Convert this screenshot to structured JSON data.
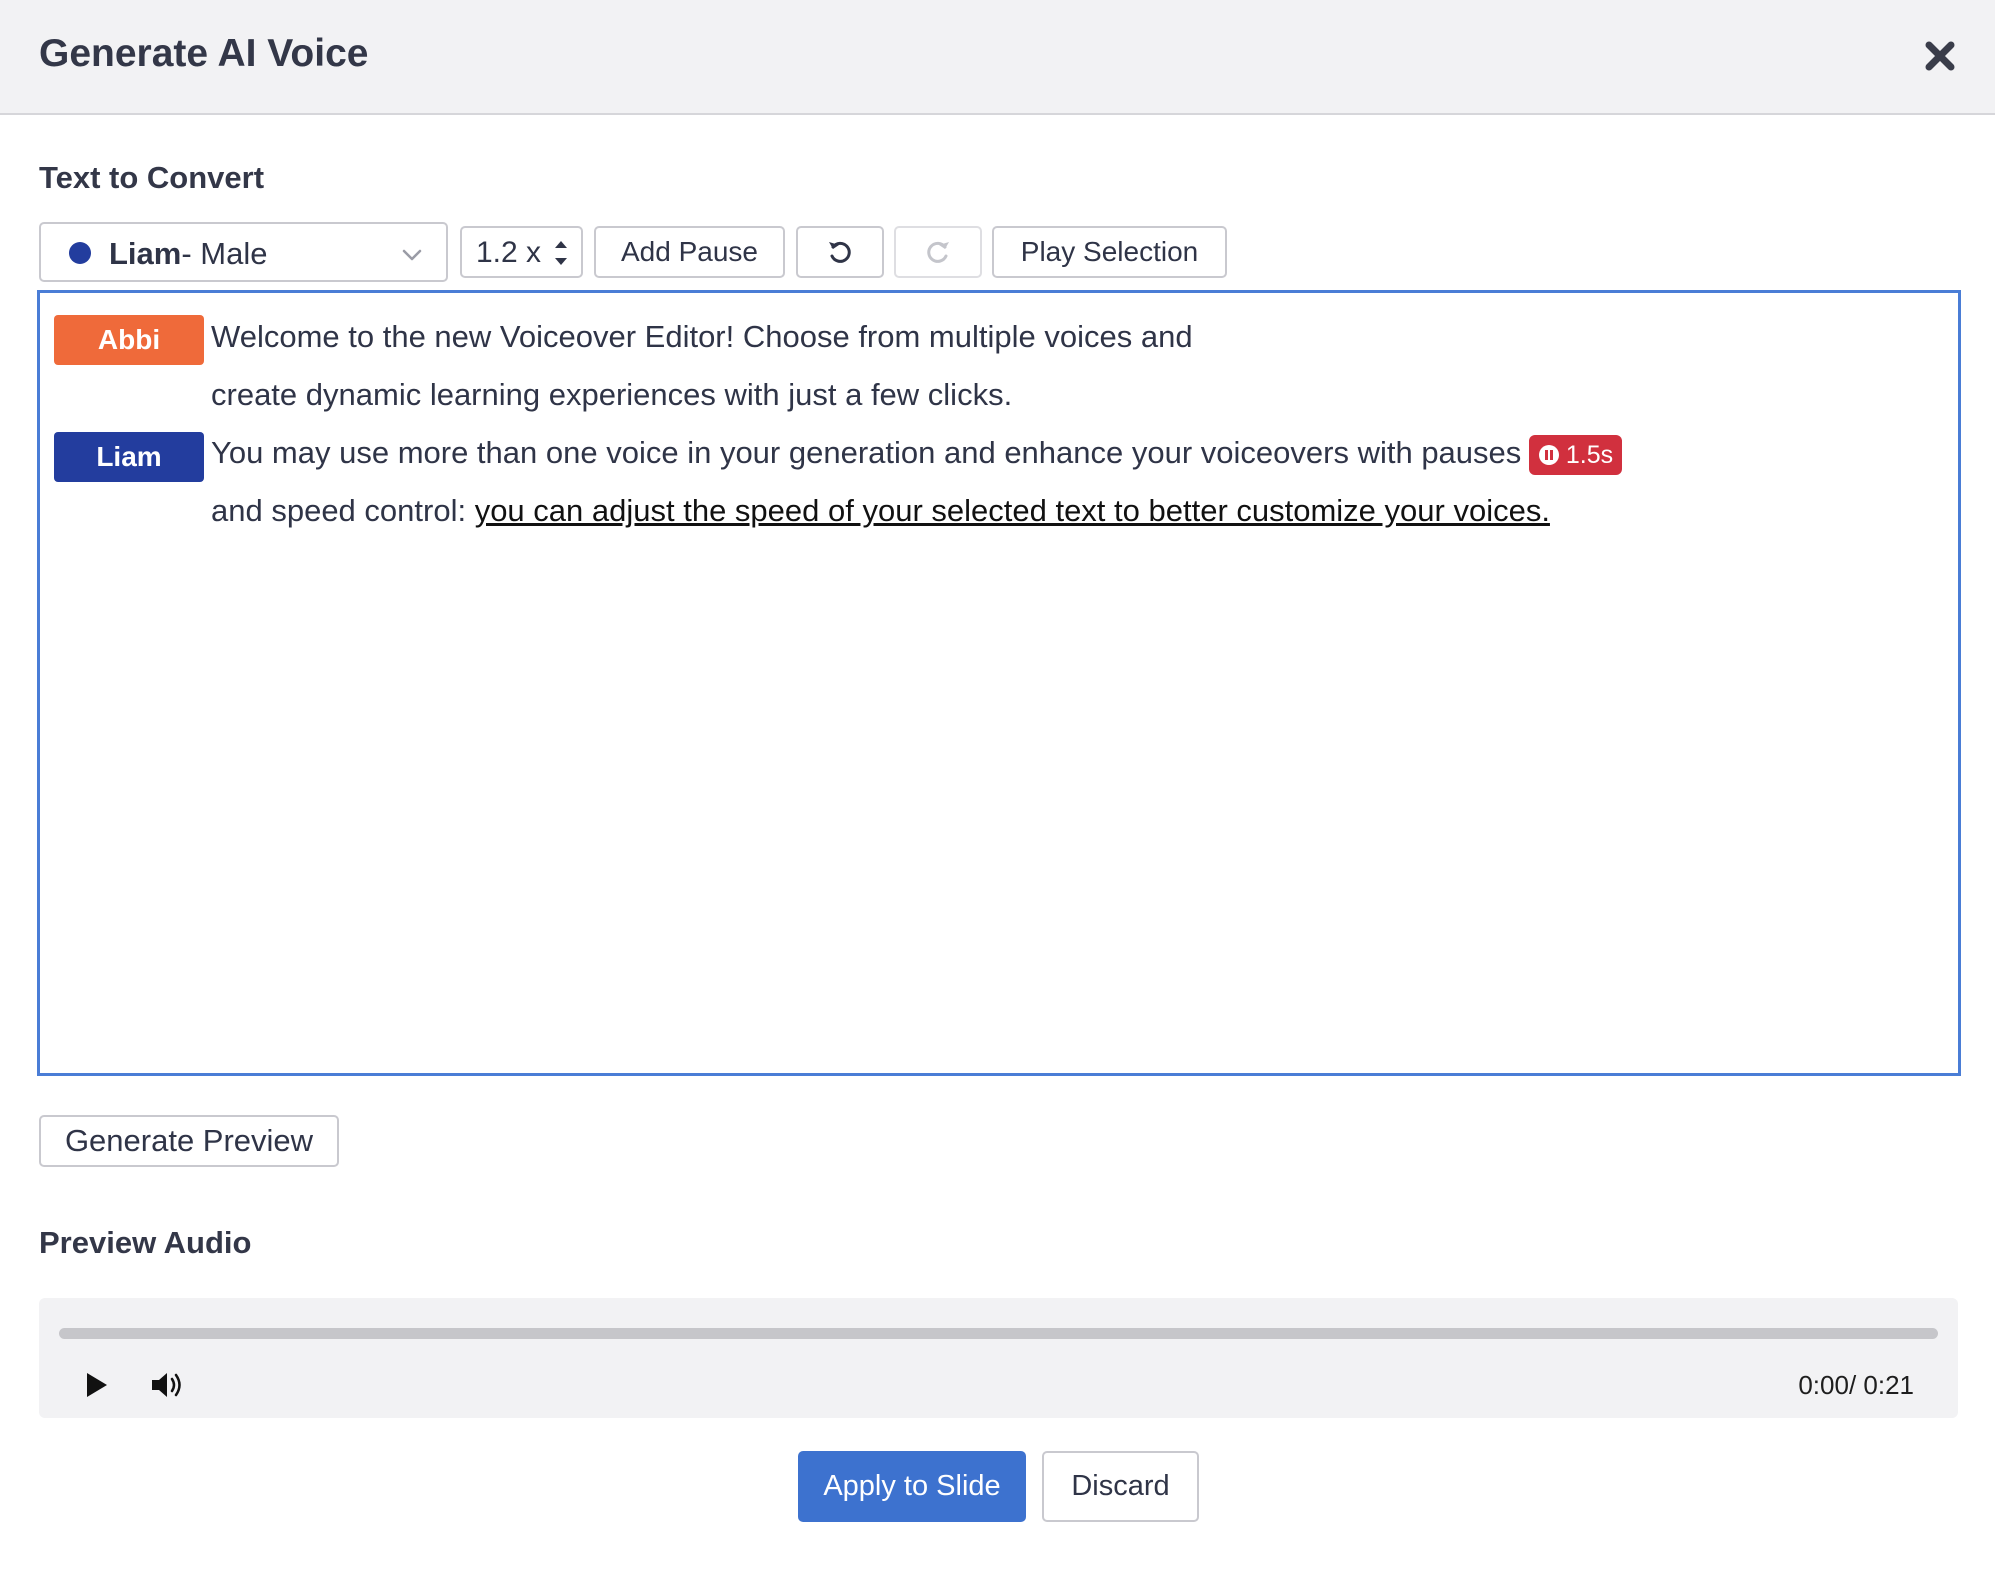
{
  "dialog": {
    "title": "Generate AI Voice"
  },
  "text_section": {
    "label": "Text to Convert"
  },
  "toolbar": {
    "voice_name": "Liam",
    "voice_desc": "- Male",
    "voice_color": "#233d9e",
    "speed_value": "1.2 x",
    "add_pause_label": "Add Pause",
    "undo_icon": "undo-icon",
    "redo_icon": "redo-icon",
    "play_selection_label": "Play Selection"
  },
  "editor": {
    "blocks": [
      {
        "speaker": "Abbi",
        "speaker_color": "#ef6a3a",
        "line1": "Welcome to the new Voiceover Editor! Choose from multiple voices and",
        "line2": "create dynamic learning experiences with just a few clicks."
      },
      {
        "speaker": "Liam",
        "speaker_color": "#233d9e",
        "line1": "You may use more than one voice in your generation and enhance your voiceovers with pauses",
        "pause_duration": "1.5s",
        "line2_prefix": "and speed control: ",
        "line2_underlined": "you can adjust the speed of your selected text to better customize your voices."
      }
    ]
  },
  "generate_preview_label": "Generate Preview",
  "preview_section": {
    "label": "Preview Audio"
  },
  "audio": {
    "time": "0:00/ 0:21",
    "progress": 0
  },
  "footer": {
    "apply_label": "Apply to Slide",
    "discard_label": "Discard",
    "primary_color": "#3d72cf"
  }
}
